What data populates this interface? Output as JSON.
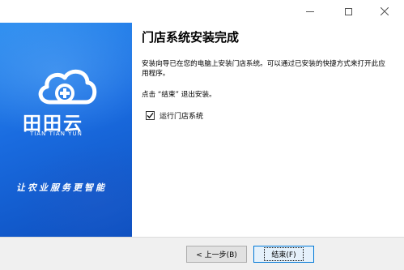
{
  "window": {
    "minimize_icon": "minimize-icon",
    "maximize_icon": "maximize-icon",
    "close_icon": "close-icon"
  },
  "banner": {
    "brand_name": "田田云",
    "brand_sub": "TIAN TIAN YUN",
    "slogan": "让农业服务更智能",
    "logo_icon": "cloud-plus-logo-icon",
    "colors": {
      "top": "#2f8ff0",
      "bottom": "#0d4fbf"
    }
  },
  "main": {
    "heading": "门店系统安装完成",
    "description": "安装向导已在您的电脑上安装门店系统。可以通过已安装的快捷方式来打开此应用程序。",
    "hint": "点击 “结束” 退出安装。",
    "run_checkbox": {
      "label": "运行门店系统",
      "checked": true
    }
  },
  "footer": {
    "back_label": "< 上一步(B)",
    "finish_label": "结束(F)"
  }
}
